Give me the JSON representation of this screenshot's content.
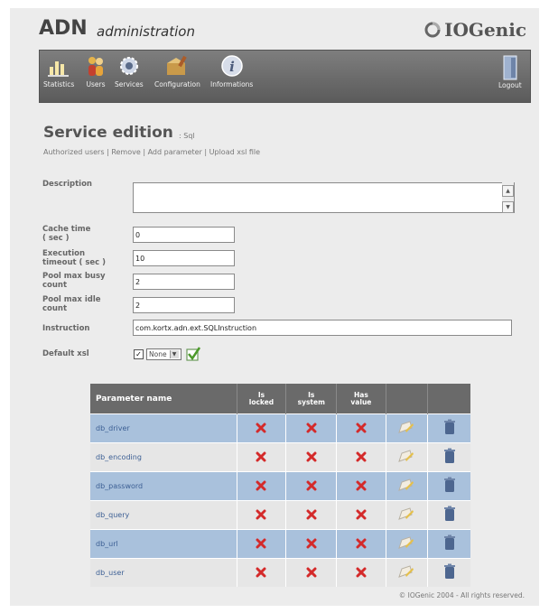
{
  "header": {
    "app_name": "ADN",
    "app_subtitle": "administration",
    "brand": "IOGenic"
  },
  "toolbar": {
    "items": [
      {
        "label": "Statistics",
        "icon": "statistics-icon"
      },
      {
        "label": "Users",
        "icon": "users-icon"
      },
      {
        "label": "Services",
        "icon": "services-icon"
      },
      {
        "label": "Configuration",
        "icon": "configuration-icon"
      },
      {
        "label": "Informations",
        "icon": "informations-icon"
      }
    ],
    "logout": "Logout"
  },
  "page": {
    "title": "Service edition",
    "subtitle": ": Sql"
  },
  "actions": [
    "Authorized users",
    "Remove",
    "Add parameter",
    "Upload xsl file"
  ],
  "form": {
    "description_label": "Description",
    "description_value": "",
    "cache_label_1": "Cache time",
    "cache_label_2": "( sec )",
    "cache_value": "0",
    "exec_label_1": "Execution",
    "exec_label_2": "timeout ( sec )",
    "exec_value": "10",
    "busy_label_1": "Pool max busy",
    "busy_label_2": "count",
    "busy_value": "2",
    "idle_label_1": "Pool max idle",
    "idle_label_2": "count",
    "idle_value": "2",
    "instruction_label": "Instruction",
    "instruction_value": "com.kortx.adn.ext.SQLInstruction",
    "xsl_label": "Default xsl",
    "xsl_checked": true,
    "xsl_selected": "None"
  },
  "table": {
    "headers": {
      "name": "Parameter name",
      "locked_1": "Is",
      "locked_2": "locked",
      "system_1": "Is",
      "system_2": "system",
      "value_1": "Has",
      "value_2": "value"
    },
    "rows": [
      {
        "name": "db_driver",
        "is_locked": false,
        "is_system": false,
        "has_value": false
      },
      {
        "name": "db_encoding",
        "is_locked": false,
        "is_system": false,
        "has_value": false
      },
      {
        "name": "db_password",
        "is_locked": false,
        "is_system": false,
        "has_value": false
      },
      {
        "name": "db_query",
        "is_locked": false,
        "is_system": false,
        "has_value": false
      },
      {
        "name": "db_url",
        "is_locked": false,
        "is_system": false,
        "has_value": false
      },
      {
        "name": "db_user",
        "is_locked": false,
        "is_system": false,
        "has_value": false
      }
    ],
    "row_colors": [
      "#a9c1dc",
      "#e6e6e6"
    ],
    "cross_color": "#d42a2a"
  },
  "footer": "© IOGenic 2004 - All rights reserved."
}
